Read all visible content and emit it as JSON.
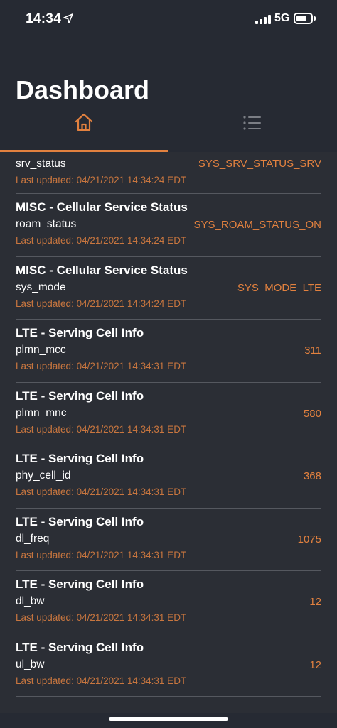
{
  "status_bar": {
    "time": "14:34",
    "network": "5G"
  },
  "header": {
    "title": "Dashboard"
  },
  "tabs": [
    {
      "name": "home",
      "icon": "home-icon",
      "active": true
    },
    {
      "name": "list",
      "icon": "list-icon",
      "active": false
    }
  ],
  "colors": {
    "accent": "#e2813f",
    "background": "#262a33"
  },
  "items": [
    {
      "title": "",
      "key": "srv_status",
      "value": "SYS_SRV_STATUS_SRV",
      "updated": "Last updated: 04/21/2021 14:34:24 EDT"
    },
    {
      "title": "MISC - Cellular Service Status",
      "key": "roam_status",
      "value": "SYS_ROAM_STATUS_ON",
      "updated": "Last updated: 04/21/2021 14:34:24 EDT"
    },
    {
      "title": "MISC - Cellular Service Status",
      "key": "sys_mode",
      "value": "SYS_MODE_LTE",
      "updated": "Last updated: 04/21/2021 14:34:24 EDT"
    },
    {
      "title": "LTE - Serving Cell Info",
      "key": "plmn_mcc",
      "value": "311",
      "updated": "Last updated: 04/21/2021 14:34:31 EDT"
    },
    {
      "title": "LTE - Serving Cell Info",
      "key": "plmn_mnc",
      "value": "580",
      "updated": "Last updated: 04/21/2021 14:34:31 EDT"
    },
    {
      "title": "LTE - Serving Cell Info",
      "key": "phy_cell_id",
      "value": "368",
      "updated": "Last updated: 04/21/2021 14:34:31 EDT"
    },
    {
      "title": "LTE - Serving Cell Info",
      "key": "dl_freq",
      "value": "1075",
      "updated": "Last updated: 04/21/2021 14:34:31 EDT"
    },
    {
      "title": "LTE - Serving Cell Info",
      "key": "dl_bw",
      "value": "12",
      "updated": "Last updated: 04/21/2021 14:34:31 EDT"
    },
    {
      "title": "LTE - Serving Cell Info",
      "key": "ul_bw",
      "value": "12",
      "updated": "Last updated: 04/21/2021 14:34:31 EDT"
    }
  ]
}
